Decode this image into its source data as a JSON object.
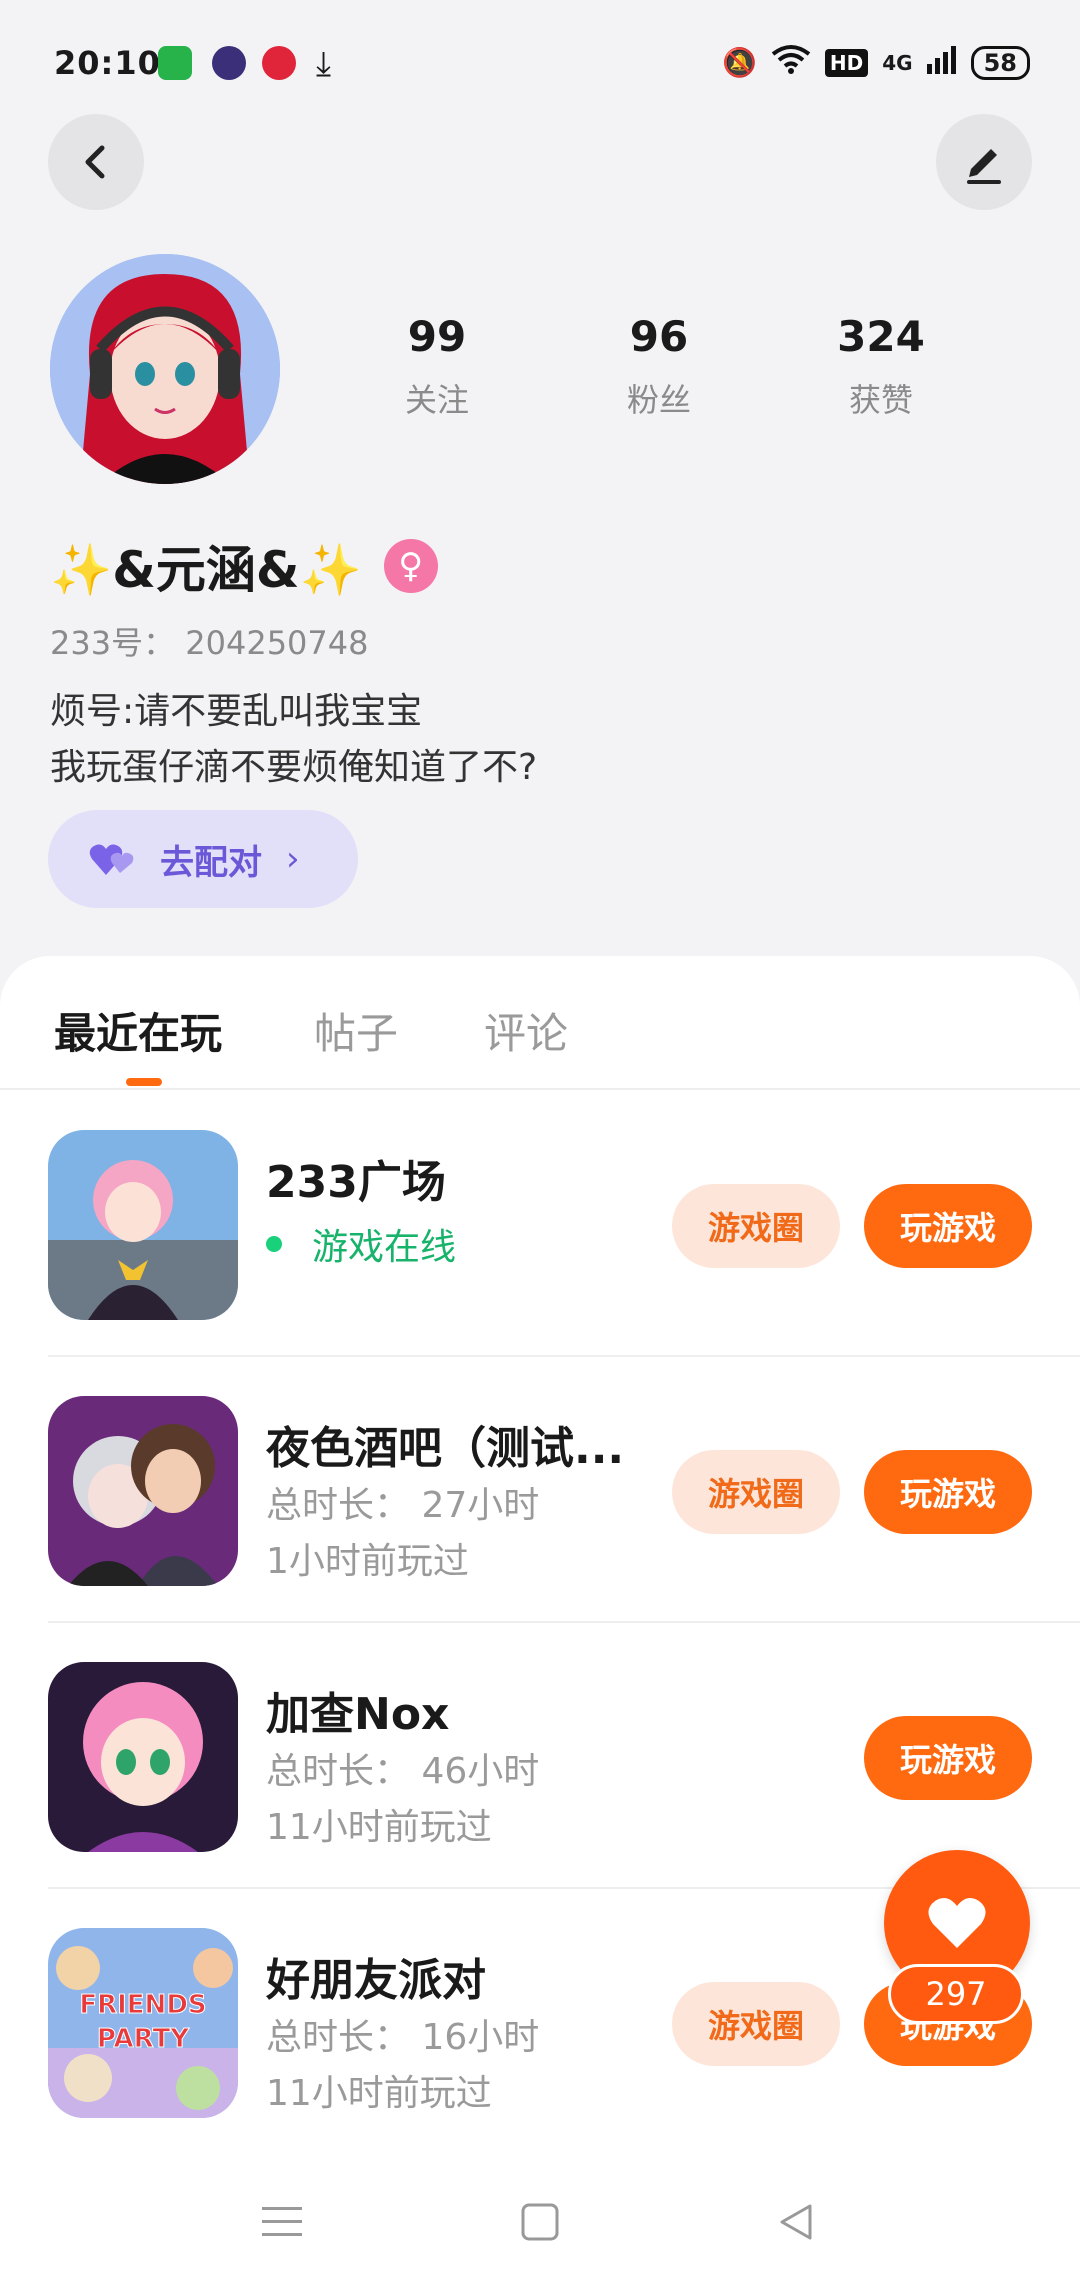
{
  "status_bar": {
    "time": "20:10",
    "network": "4G",
    "hd": "HD",
    "battery": "58",
    "app_icons": [
      "wechat-like-icon",
      "browser-icon",
      "video-icon",
      "download-icon"
    ],
    "system_icons": [
      "mute-icon",
      "wifi-icon",
      "hd-icon",
      "signal-icon",
      "battery-icon"
    ]
  },
  "header": {
    "back_icon": "chevron-left-icon",
    "edit_icon": "edit-icon"
  },
  "profile": {
    "nickname": "✨&元涵&✨",
    "gender_symbol": "♀",
    "user_id": "233号： 204250748",
    "bio_line1": "烦号:请不要乱叫我宝宝",
    "bio_line2": "我玩蛋仔滴不要烦俺知道了不?",
    "stats": [
      {
        "value": "99",
        "label": "关注"
      },
      {
        "value": "96",
        "label": "粉丝"
      },
      {
        "value": "324",
        "label": "获赞"
      }
    ],
    "match_button": "去配对",
    "match_chevron": "›"
  },
  "tabs": [
    {
      "label": "最近在玩",
      "active": true
    },
    {
      "label": "帖子",
      "active": false
    },
    {
      "label": "评论",
      "active": false
    }
  ],
  "games": [
    {
      "name": "233广场",
      "status": "游戏在线",
      "circle_label": "游戏圈",
      "play_label": "玩游戏"
    },
    {
      "name": "夜色酒吧（测试...",
      "duration": "总时长： 27小时",
      "last_played": "1小时前玩过",
      "circle_label": "游戏圈",
      "play_label": "玩游戏"
    },
    {
      "name": "加查Nox",
      "duration": "总时长： 46小时",
      "last_played": "11小时前玩过",
      "play_label": "玩游戏"
    },
    {
      "name": "好朋友派对",
      "duration": "总时长： 16小时",
      "last_played": "11小时前玩过",
      "circle_label": "游戏圈",
      "play_label": "玩游戏",
      "icon_text": "FRIENDS PARTY"
    }
  ],
  "like_fab": {
    "count": "297"
  },
  "colors": {
    "accent": "#ff6a10",
    "accent_light": "#fde6d9",
    "match_bg": "#e2dff8",
    "match_text": "#6a58d8",
    "online": "#17b36b",
    "gender": "#f577a7"
  }
}
